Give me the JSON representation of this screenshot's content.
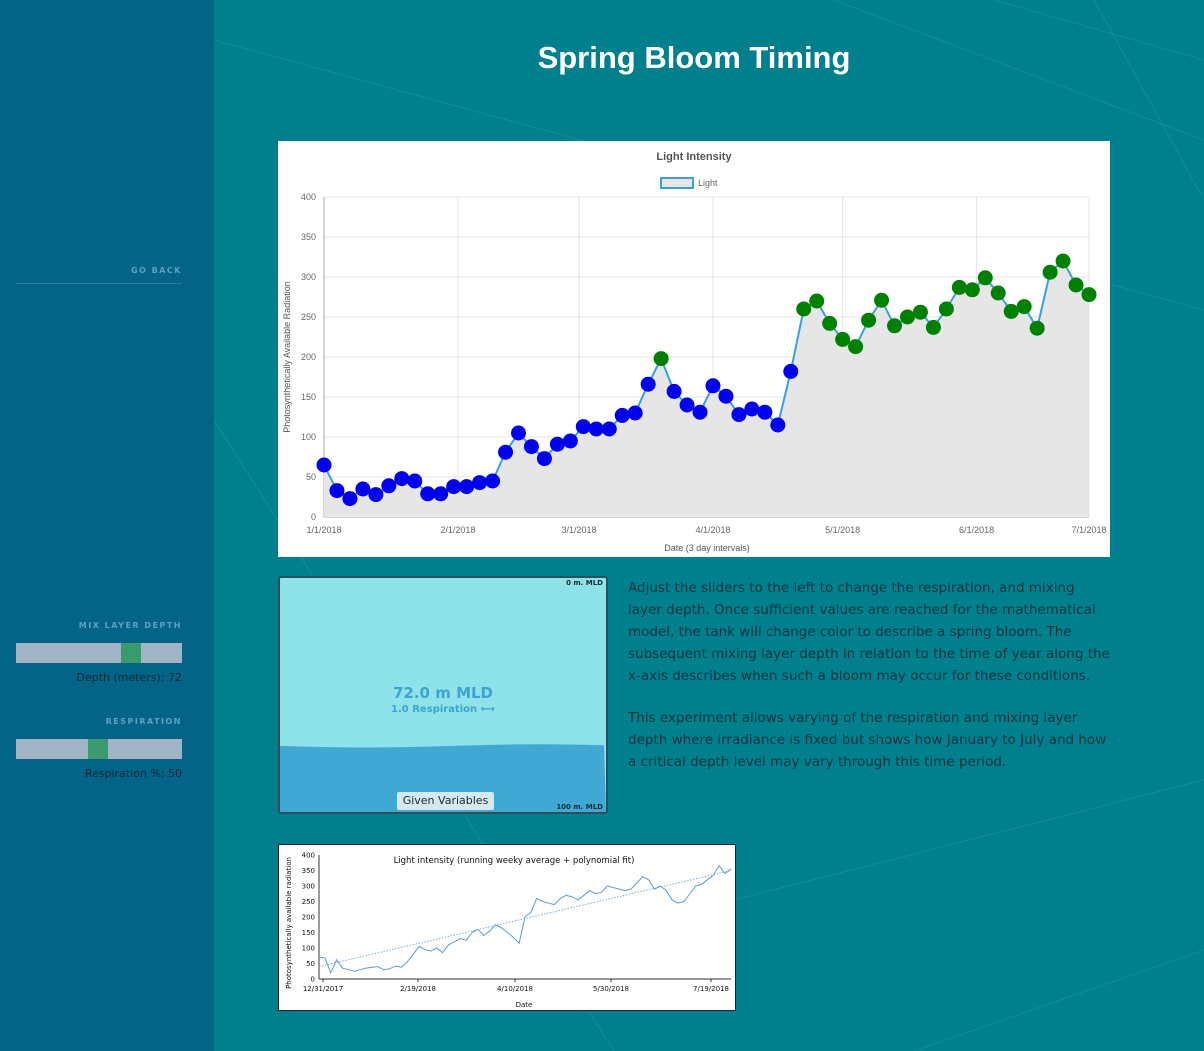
{
  "page": {
    "title": "Spring Bloom Timing",
    "colors": {
      "background": "#007f8d",
      "sidebar": "#046488",
      "slider_thumb": "#3a9a6e",
      "slider_track": "#9fb5c5"
    }
  },
  "sidebar": {
    "go_back": "GO BACK",
    "mix_layer": {
      "title": "MIX LAYER DEPTH",
      "value_label": "Depth (meters): 72",
      "value": 72,
      "min": 0,
      "max": 100
    },
    "respiration": {
      "title": "RESPIRATION",
      "value_label": "Respiration %: 50",
      "value": 50,
      "min": 0,
      "max": 100
    }
  },
  "tank": {
    "top_label": "0 m. MLD",
    "bottom_label": "100 m. MLD",
    "mld_text": "72.0 m MLD",
    "resp_text": "1.0 Respiration ⟷",
    "button_label": "Given Variables",
    "mix_depth": 72,
    "max_depth": 100
  },
  "description": {
    "p1": "Adjust the sliders to the left to change the respiration, and mixing layer depth. Once sufficient values are reached for the mathematical model, the tank will change color to describe a spring bloom. The subsequent mixing layer depth in relation to the time of year along the x-axis describes when such a bloom may occur for these conditions.",
    "p2": "This experiment allows varying of the respiration and mixing layer depth where irradiance is fixed but shows how January to July and how a critical depth level may vary through this time period."
  },
  "chart_data": [
    {
      "type": "line",
      "title": "Light Intensity",
      "legend": "Light",
      "legend_position": "top",
      "xlabel": "Date (3 day intervals)",
      "ylabel": "Photosynthetically Available Radiation",
      "ylim": [
        0,
        400
      ],
      "yticks": [
        0,
        50,
        100,
        150,
        200,
        250,
        300,
        350,
        400
      ],
      "xticks": [
        "1/1/2018",
        "2/1/2018",
        "3/1/2018",
        "4/1/2018",
        "5/1/2018",
        "6/1/2018",
        "7/1/2018"
      ],
      "grid": true,
      "fill": "area",
      "point_colors": {
        "no_bloom": "#0000ee",
        "bloom": "#008000"
      },
      "series": [
        {
          "name": "Light",
          "values": [
            65,
            33,
            23,
            35,
            28,
            39,
            48,
            45,
            29,
            29,
            38,
            38,
            43,
            45,
            81,
            105,
            88,
            73,
            91,
            95,
            113,
            110,
            110,
            127,
            130,
            166,
            198,
            157,
            140,
            131,
            164,
            151,
            128,
            135,
            131,
            115,
            182,
            260,
            270,
            242,
            222,
            213,
            246,
            271,
            239,
            250,
            256,
            237,
            260,
            287,
            284,
            299,
            280,
            257,
            263,
            236,
            306,
            320,
            290,
            278
          ],
          "bloom": [
            0,
            0,
            0,
            0,
            0,
            0,
            0,
            0,
            0,
            0,
            0,
            0,
            0,
            0,
            0,
            0,
            0,
            0,
            0,
            0,
            0,
            0,
            0,
            0,
            0,
            0,
            1,
            0,
            0,
            0,
            0,
            0,
            0,
            0,
            0,
            0,
            0,
            1,
            1,
            1,
            1,
            1,
            1,
            1,
            1,
            1,
            1,
            1,
            1,
            1,
            1,
            1,
            1,
            1,
            1,
            1,
            1,
            1,
            1,
            1
          ]
        }
      ]
    },
    {
      "type": "line",
      "title": "Light intensity (running weeky average + polynomial fit)",
      "xlabel": "Date",
      "ylabel": "Photosynthetically available radiation",
      "ylim": [
        0,
        400
      ],
      "yticks": [
        0,
        50,
        100,
        150,
        200,
        250,
        300,
        350,
        400
      ],
      "xticks": [
        "12/31/2017",
        "2/19/2018",
        "4/10/2018",
        "5/30/2018",
        "7/19/2018"
      ],
      "series": [
        {
          "name": "running average",
          "values": [
            70,
            68,
            20,
            62,
            35,
            30,
            25,
            30,
            35,
            38,
            40,
            30,
            33,
            42,
            38,
            55,
            80,
            105,
            95,
            90,
            100,
            85,
            110,
            120,
            130,
            125,
            150,
            160,
            140,
            155,
            175,
            165,
            150,
            135,
            115,
            200,
            215,
            260,
            250,
            245,
            240,
            260,
            270,
            265,
            255,
            270,
            285,
            275,
            280,
            300,
            295,
            290,
            285,
            290,
            310,
            330,
            320,
            290,
            300,
            285,
            255,
            245,
            250,
            275,
            300,
            305,
            320,
            335,
            365,
            340,
            355
          ]
        },
        {
          "name": "polynomial fit",
          "values": [
            40,
            350
          ]
        }
      ]
    }
  ]
}
